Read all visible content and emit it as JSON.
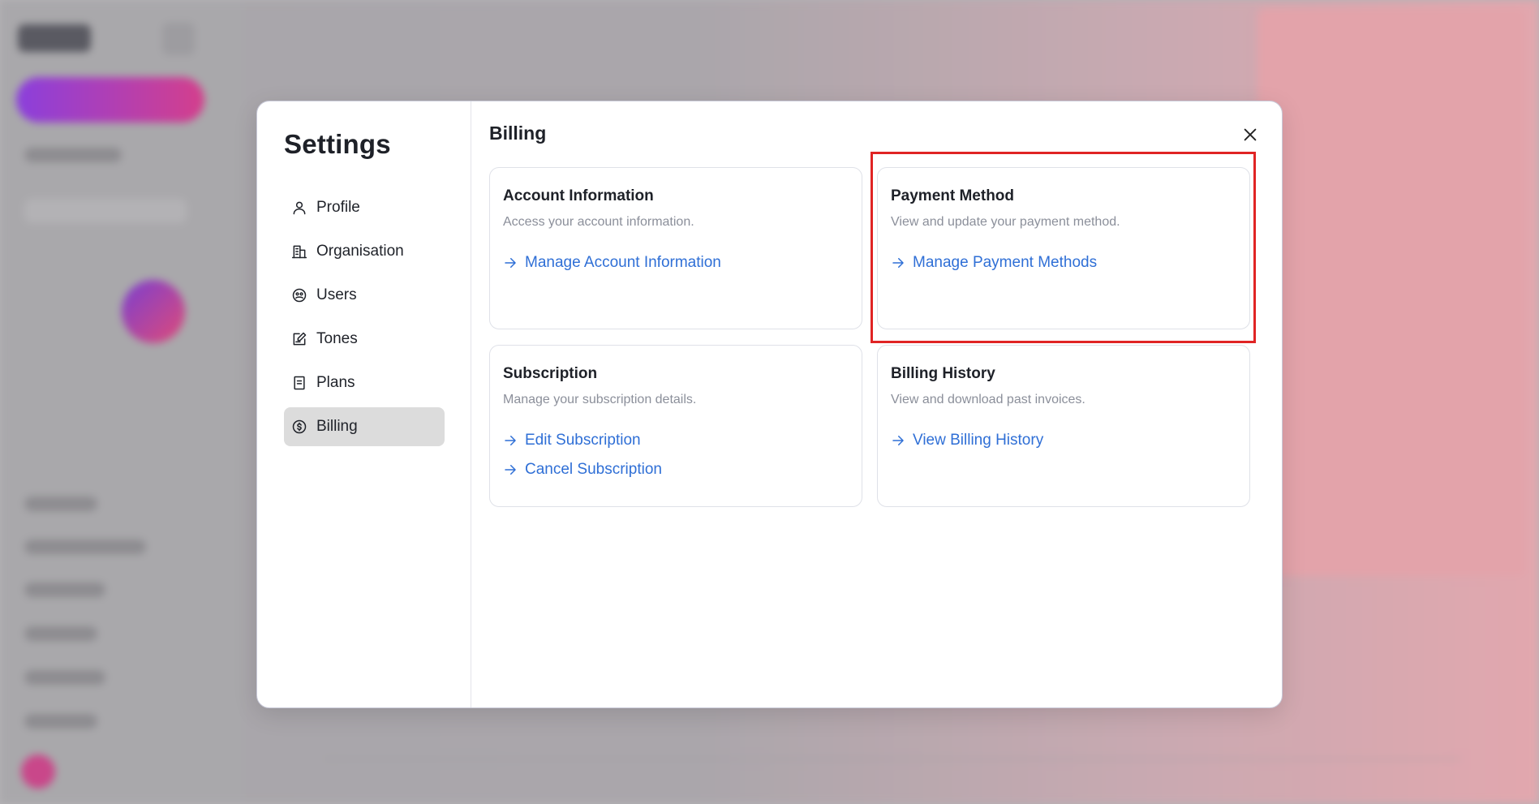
{
  "settings": {
    "title": "Settings",
    "nav": [
      {
        "label": "Profile",
        "icon": "user-icon"
      },
      {
        "label": "Organisation",
        "icon": "building-icon"
      },
      {
        "label": "Users",
        "icon": "users-icon"
      },
      {
        "label": "Tones",
        "icon": "edit-note-icon"
      },
      {
        "label": "Plans",
        "icon": "document-icon"
      },
      {
        "label": "Billing",
        "icon": "billing-icon",
        "active": true
      }
    ]
  },
  "billing": {
    "title": "Billing",
    "cards": {
      "account": {
        "title": "Account Information",
        "description": "Access your account information.",
        "links": [
          "Manage Account Information"
        ]
      },
      "payment": {
        "title": "Payment Method",
        "description": "View and update your payment method.",
        "links": [
          "Manage Payment Methods"
        ]
      },
      "subscription": {
        "title": "Subscription",
        "description": "Manage your subscription details.",
        "links": [
          "Edit Subscription",
          "Cancel Subscription"
        ]
      },
      "history": {
        "title": "Billing History",
        "description": "View and download past invoices.",
        "links": [
          "View Billing History"
        ]
      }
    }
  },
  "colors": {
    "link": "#2f6fd6",
    "highlight": "#e02424",
    "active_nav": "#dcdcdc"
  }
}
